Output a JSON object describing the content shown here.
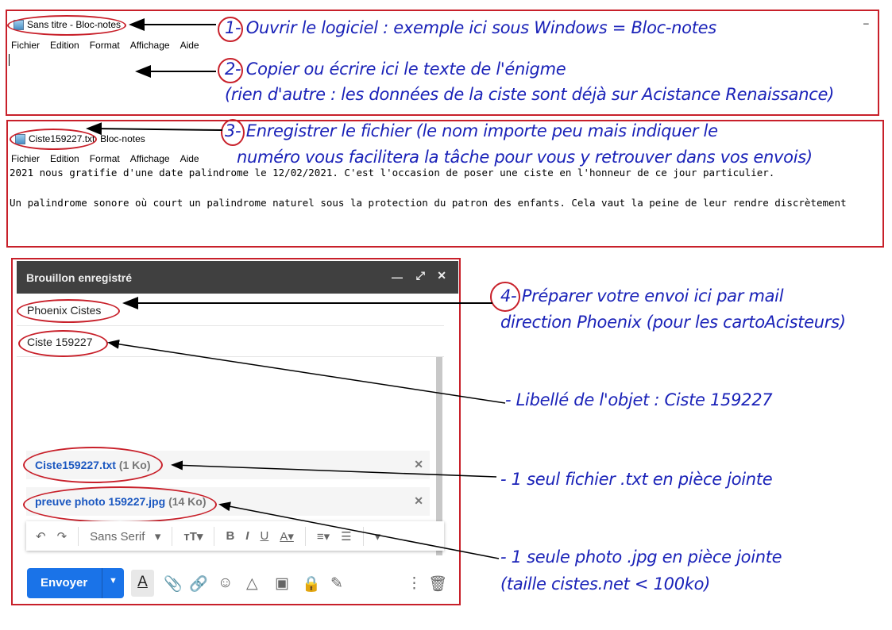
{
  "notepad1": {
    "title": "Sans titre - Bloc-notes",
    "menu": [
      "Fichier",
      "Edition",
      "Format",
      "Affichage",
      "Aide"
    ],
    "minimize": "–"
  },
  "notepad2": {
    "filename": "Ciste159227.txt",
    "app": "Bloc-notes",
    "menu": [
      "Fichier",
      "Edition",
      "Format",
      "Affichage",
      "Aide"
    ],
    "lines": [
      "2021 nous gratifie d'une date palindrome le 12/02/2021. C'est l'occasion de poser une ciste en l'honneur de ce jour particulier.",
      "Un palindrome sonore où court un palindrome naturel sous la protection du patron des enfants. Cela vaut la peine de leur rendre discrètement"
    ]
  },
  "gmail": {
    "header": "Brouillon enregistré",
    "to": "Phoenix Cistes",
    "subject": "Ciste 159227",
    "attachments": [
      {
        "name": "Ciste159227.txt",
        "size": "(1 Ko)"
      },
      {
        "name": "preuve photo 159227.jpg",
        "size": "(14 Ko)"
      }
    ],
    "font": "Sans Serif",
    "send": "Envoyer"
  },
  "annotations": {
    "n1": "1-",
    "a1": " Ouvrir le logiciel : exemple ici sous Windows = Bloc-notes",
    "n2": "2-",
    "a2": " Copier ou écrire ici le texte de l'énigme",
    "a2b": "(rien d'autre : les données de la ciste sont déjà sur Acistance Renaissance)",
    "n3": "3-",
    "a3": "  Enregistrer le fichier (le nom importe peu mais indiquer le",
    "a3b": "numéro vous facilitera la tâche pour vous y retrouver dans vos envois)",
    "n4": "4-",
    "a4": " Préparer votre envoi ici par mail",
    "a4b": "direction Phoenix (pour les cartoAcisteurs)",
    "a5": "- Libellé de l'objet : Ciste 159227",
    "a6": "- 1 seul fichier .txt en pièce jointe",
    "a7": "- 1 seule photo .jpg en pièce jointe",
    "a7b": "(taille cistes.net < 100ko)"
  },
  "colors": {
    "annotation": "#1a22b8",
    "frame": "#c8202a",
    "send": "#1a73e8",
    "header": "#404040"
  }
}
